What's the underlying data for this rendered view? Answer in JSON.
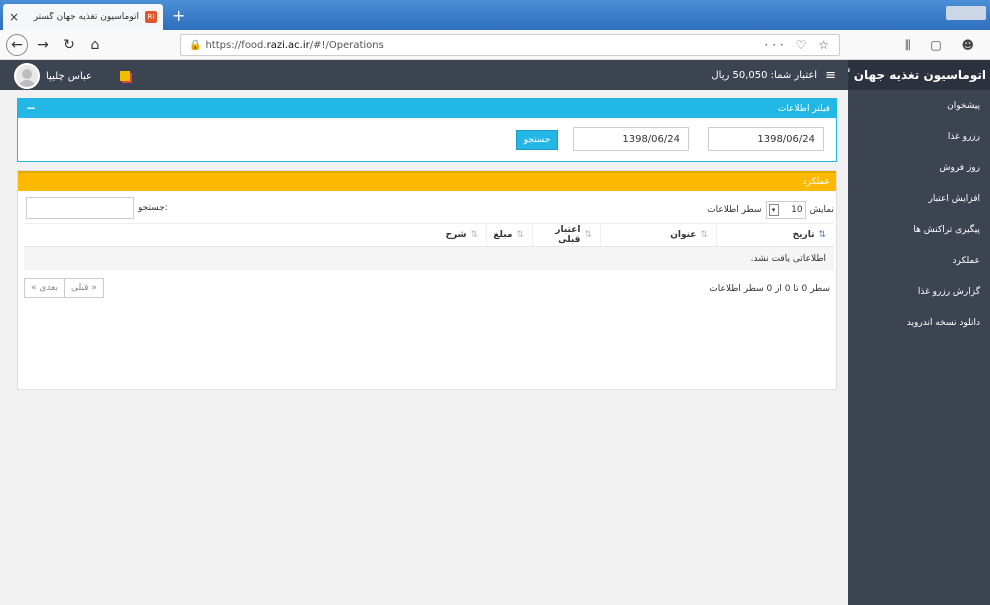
{
  "browser": {
    "tab_title": "اتوماسیون تغذیه جهان گستر",
    "favicon": "RI",
    "url_prefix": "https://food.",
    "url_domain": "razi.ac.ir",
    "url_path": "/#!/Operations",
    "url_icons": "··· ♡ ☆",
    "right_icons": "⫼ ▢ ☻"
  },
  "header": {
    "brand": "اتوماسیون تغذیه جهان گستر",
    "credit": "اعتبار شما: 50,050 ریال",
    "menu_icon": "≡",
    "user_name": "عباس چلیپا"
  },
  "sidebar": {
    "items": [
      {
        "label": "پیشخوان"
      },
      {
        "label": "رزرو غذا"
      },
      {
        "label": "روز فروش"
      },
      {
        "label": "افزایش اعتبار"
      },
      {
        "label": "پیگیری تراکنش ها"
      },
      {
        "label": "عملکرد"
      },
      {
        "label": "گزارش رزرو غذا"
      },
      {
        "label": "دانلود نسخه اندروید"
      }
    ]
  },
  "filter": {
    "title": "فیلتر اطلاعات",
    "collapse": "−",
    "date_from": "1398/06/24",
    "date_to": "1398/06/24",
    "search_button": "جستجو"
  },
  "performance": {
    "title": "عملکرد",
    "show_label": "نمایش",
    "page_size": "10",
    "rows_label": "سطر اطلاعات",
    "search_label": "جستجو:",
    "columns": [
      "تاریخ",
      "عنوان",
      "اعتبار قبلی",
      "مبلغ",
      "شرح"
    ],
    "empty_message": "اطلاعاتی یافت نشد.",
    "info": "سطر 0 تا 0 از 0 سطر اطلاعات",
    "prev": "« قبلی",
    "next": "بعدی »"
  },
  "colors": {
    "info": "#23b7e5",
    "warning": "#fcb900",
    "sidebar": "#3c4452"
  }
}
